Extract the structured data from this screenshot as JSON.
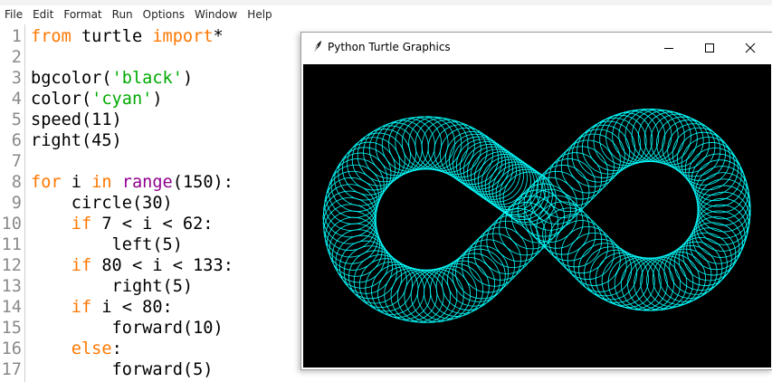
{
  "menubar": {
    "items": [
      "File",
      "Edit",
      "Format",
      "Run",
      "Options",
      "Window",
      "Help"
    ]
  },
  "editor": {
    "lines": [
      {
        "num": "1",
        "tokens": [
          {
            "t": "kw",
            "v": "from"
          },
          {
            "t": "n",
            "v": " turtle "
          },
          {
            "t": "kw",
            "v": "import"
          },
          {
            "t": "n",
            "v": "*"
          }
        ]
      },
      {
        "num": "2",
        "tokens": []
      },
      {
        "num": "3",
        "tokens": [
          {
            "t": "n",
            "v": "bgcolor("
          },
          {
            "t": "str",
            "v": "'black'"
          },
          {
            "t": "n",
            "v": ")"
          }
        ]
      },
      {
        "num": "4",
        "tokens": [
          {
            "t": "n",
            "v": "color("
          },
          {
            "t": "str",
            "v": "'cyan'"
          },
          {
            "t": "n",
            "v": ")"
          }
        ]
      },
      {
        "num": "5",
        "tokens": [
          {
            "t": "n",
            "v": "speed(11)"
          }
        ]
      },
      {
        "num": "6",
        "tokens": [
          {
            "t": "n",
            "v": "right(45)"
          }
        ]
      },
      {
        "num": "7",
        "tokens": []
      },
      {
        "num": "8",
        "tokens": [
          {
            "t": "kw",
            "v": "for"
          },
          {
            "t": "n",
            "v": " i "
          },
          {
            "t": "kw",
            "v": "in"
          },
          {
            "t": "n",
            "v": " "
          },
          {
            "t": "bi",
            "v": "range"
          },
          {
            "t": "n",
            "v": "(150):"
          }
        ]
      },
      {
        "num": "9",
        "tokens": [
          {
            "t": "n",
            "v": "    circle(30)"
          }
        ]
      },
      {
        "num": "10",
        "tokens": [
          {
            "t": "n",
            "v": "    "
          },
          {
            "t": "kw",
            "v": "if"
          },
          {
            "t": "n",
            "v": " 7 < i < 62:"
          }
        ]
      },
      {
        "num": "11",
        "tokens": [
          {
            "t": "n",
            "v": "        left(5)"
          }
        ]
      },
      {
        "num": "12",
        "tokens": [
          {
            "t": "n",
            "v": "    "
          },
          {
            "t": "kw",
            "v": "if"
          },
          {
            "t": "n",
            "v": " 80 < i < 133:"
          }
        ]
      },
      {
        "num": "13",
        "tokens": [
          {
            "t": "n",
            "v": "        right(5)"
          }
        ]
      },
      {
        "num": "14",
        "tokens": [
          {
            "t": "n",
            "v": "    "
          },
          {
            "t": "kw",
            "v": "if"
          },
          {
            "t": "n",
            "v": " i < 80:"
          }
        ]
      },
      {
        "num": "15",
        "tokens": [
          {
            "t": "n",
            "v": "        forward(10)"
          }
        ]
      },
      {
        "num": "16",
        "tokens": [
          {
            "t": "n",
            "v": "    "
          },
          {
            "t": "kw",
            "v": "else"
          },
          {
            "t": "n",
            "v": ":"
          }
        ]
      },
      {
        "num": "17",
        "tokens": [
          {
            "t": "n",
            "v": "        forward(5)"
          }
        ]
      }
    ]
  },
  "turtle_window": {
    "title": "Python Turtle Graphics",
    "icons": [
      "feather-icon",
      "minimize-icon",
      "maximize-icon",
      "close-icon"
    ],
    "background_color": "#000000",
    "pen_color": "#00ffff",
    "drawing": {
      "bgcolor": "black",
      "color": "cyan",
      "speed": 11,
      "initial_right": 45,
      "iterations": 150,
      "circle_radius": 30,
      "left_range": [
        7,
        62
      ],
      "left_angle": 5,
      "right_range": [
        80,
        133
      ],
      "right_angle": 5,
      "forward_threshold": 80,
      "forward_long": 10,
      "forward_short": 5
    }
  }
}
